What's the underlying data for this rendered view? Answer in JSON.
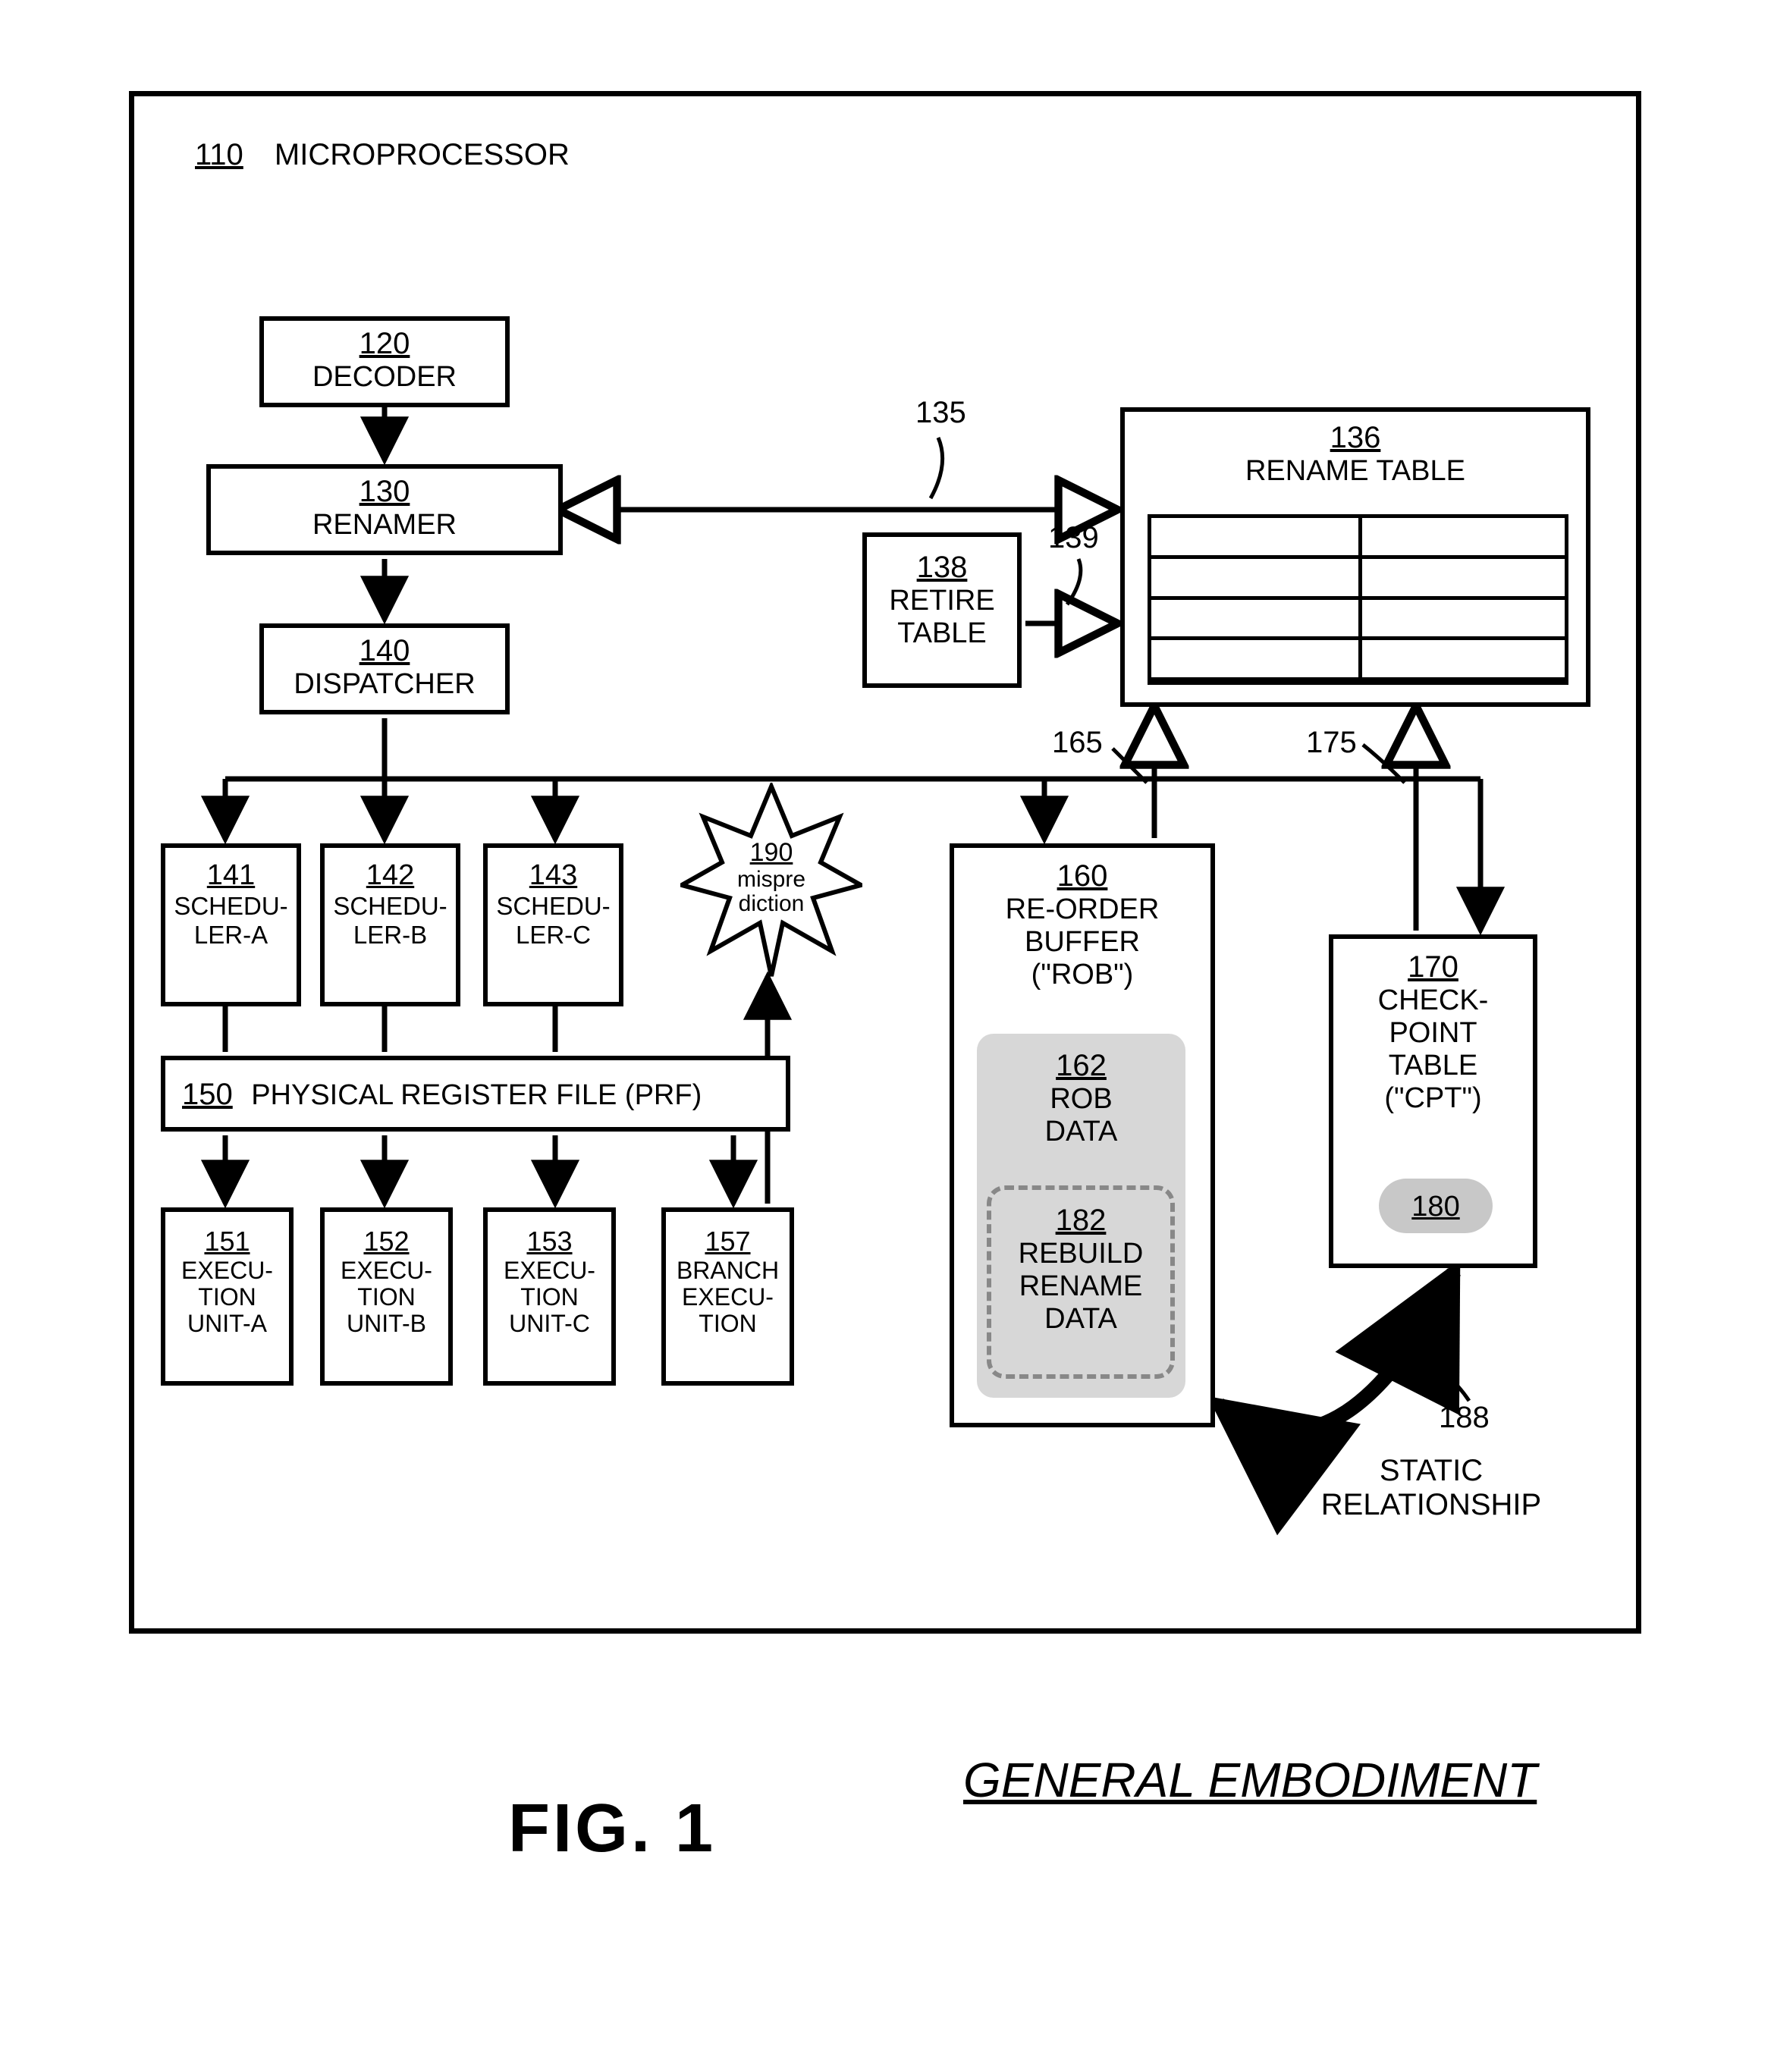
{
  "figure_label": "FIG. 1",
  "subtitle": "GENERAL EMBODIMENT",
  "outer": {
    "num": "110",
    "label": "MICROPROCESSOR"
  },
  "blocks": {
    "decoder": {
      "num": "120",
      "label": "DECODER"
    },
    "renamer": {
      "num": "130",
      "label": "RENAMER"
    },
    "dispatcher": {
      "num": "140",
      "label": "DISPATCHER"
    },
    "sched_a": {
      "num": "141",
      "label": "SCHEDU-LER-A"
    },
    "sched_b": {
      "num": "142",
      "label": "SCHEDU-LER-B"
    },
    "sched_c": {
      "num": "143",
      "label": "SCHEDU-LER-C"
    },
    "prf": {
      "num": "150",
      "label": "PHYSICAL REGISTER FILE (PRF)"
    },
    "exec_a": {
      "num": "151",
      "label": "EXECU-TION UNIT-A"
    },
    "exec_b": {
      "num": "152",
      "label": "EXECU-TION UNIT-B"
    },
    "exec_c": {
      "num": "153",
      "label": "EXECU-TION UNIT-C"
    },
    "branch": {
      "num": "157",
      "label": "BRANCH EXECU-TION"
    },
    "rob": {
      "num": "160",
      "label": "RE-ORDER BUFFER (\"ROB\")"
    },
    "rob_data": {
      "num": "162",
      "label": "ROB DATA"
    },
    "rebuild": {
      "num": "182",
      "label": "REBUILD RENAME DATA"
    },
    "cpt": {
      "num": "170",
      "label": "CHECK-POINT TABLE (\"CPT\")"
    },
    "cpt_pill": {
      "num": "180"
    },
    "retire": {
      "num": "138",
      "label": "RETIRE TABLE"
    },
    "rename": {
      "num": "136",
      "label": "RENAME TABLE"
    },
    "mispredict": {
      "num": "190",
      "label": "mispre diction"
    }
  },
  "refs": {
    "r135": "135",
    "r139": "139",
    "r165": "165",
    "r175": "175",
    "r188_num": "188",
    "r188_lbl": "STATIC RELATIONSHIP"
  }
}
